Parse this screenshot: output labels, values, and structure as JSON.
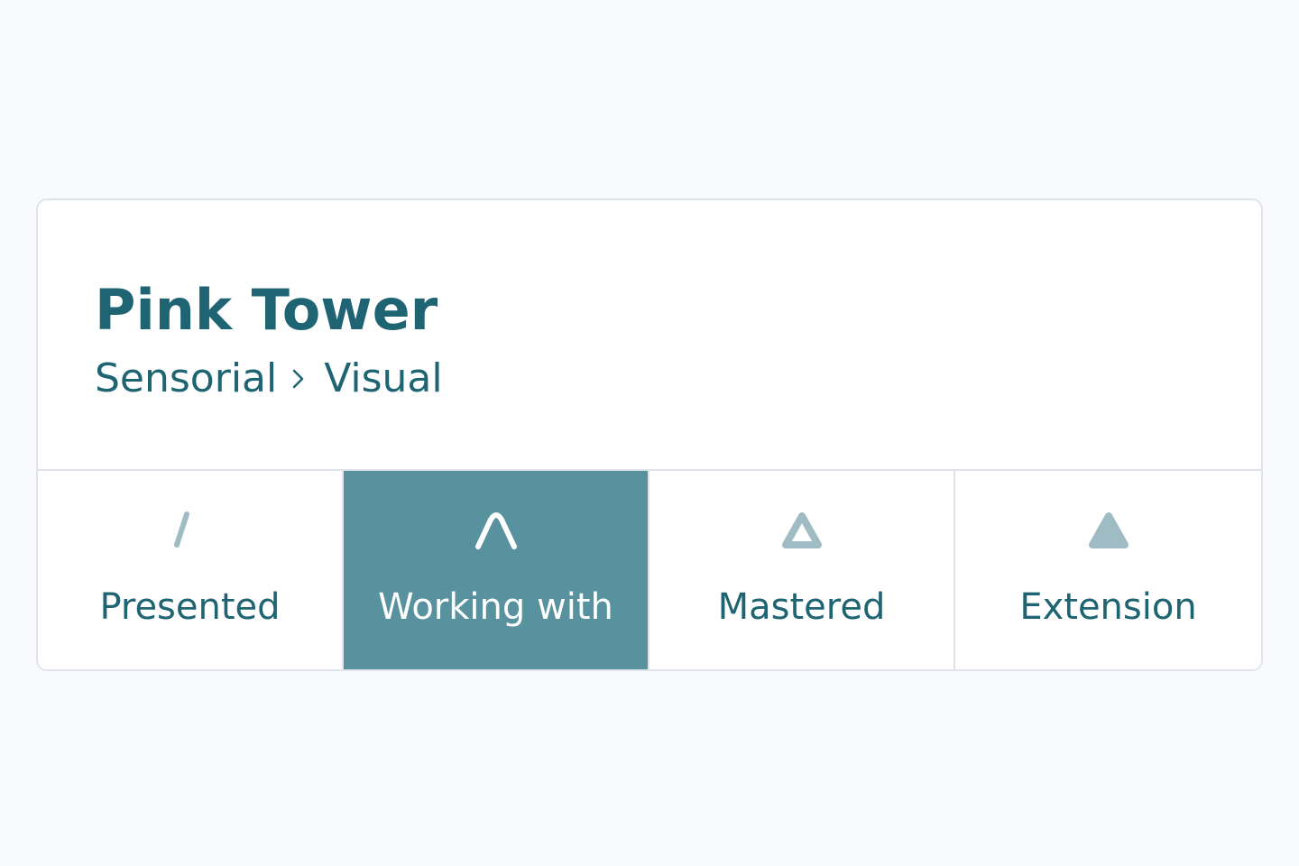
{
  "lesson": {
    "title": "Pink Tower",
    "breadcrumb": {
      "area": "Sensorial",
      "separator_icon": "chevron-right-icon",
      "subarea": "Visual"
    }
  },
  "statuses": [
    {
      "label": "Presented",
      "icon": "one-stroke-triangle-icon",
      "active": false
    },
    {
      "label": "Working with",
      "icon": "two-stroke-triangle-icon",
      "active": true
    },
    {
      "label": "Mastered",
      "icon": "outline-triangle-icon",
      "active": false
    },
    {
      "label": "Extension",
      "icon": "filled-triangle-icon",
      "active": false
    }
  ],
  "colors": {
    "brand_text": "#1f6473",
    "active_background": "#58929e",
    "icon_muted": "#9fbbc3",
    "active_icon": "#ffffff",
    "border": "#dfe3e9",
    "page_background": "#f9fafc"
  }
}
